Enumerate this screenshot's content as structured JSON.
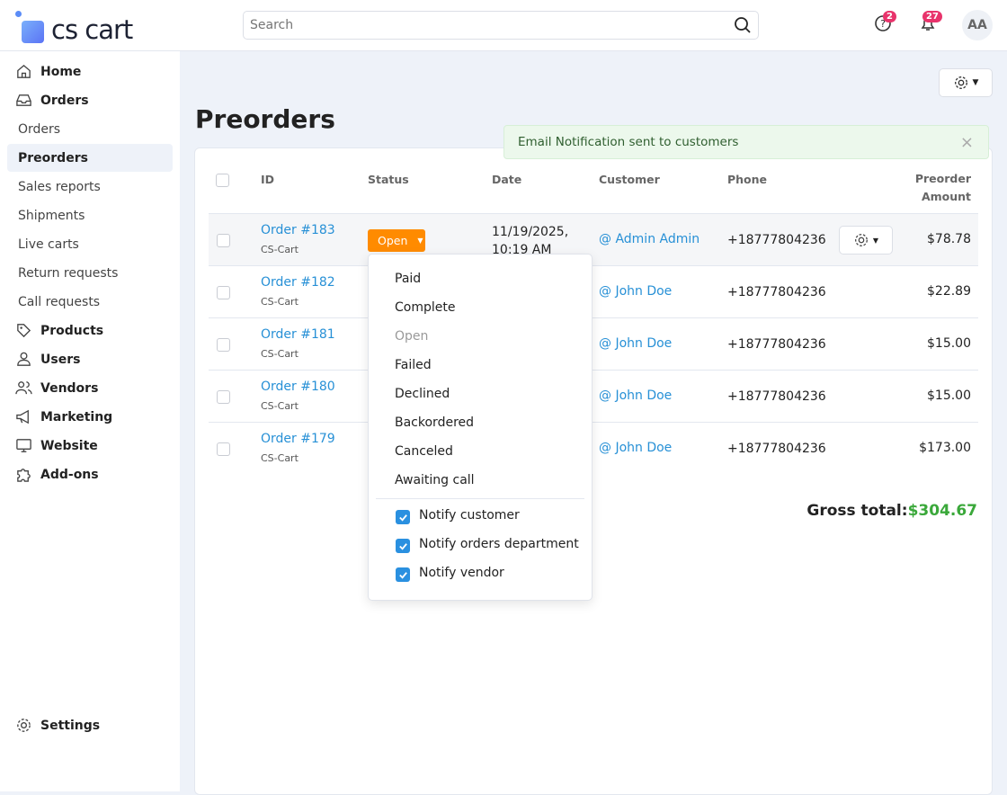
{
  "app": {
    "logo": "cs cart"
  },
  "header": {
    "search_placeholder": "Search",
    "help_badge": "2",
    "notifications_badge": "27",
    "avatar": "AA"
  },
  "sidebar": {
    "items": [
      {
        "label": "Home",
        "type": "top",
        "icon": "home-icon"
      },
      {
        "label": "Orders",
        "type": "top",
        "icon": "inbox-icon"
      },
      {
        "label": "Orders",
        "type": "sub"
      },
      {
        "label": "Preorders",
        "type": "sub",
        "active": true
      },
      {
        "label": "Sales reports",
        "type": "sub"
      },
      {
        "label": "Shipments",
        "type": "sub"
      },
      {
        "label": "Live carts",
        "type": "sub"
      },
      {
        "label": "Return requests",
        "type": "sub"
      },
      {
        "label": "Call requests",
        "type": "sub"
      },
      {
        "label": "Products",
        "type": "top",
        "icon": "tag-icon"
      },
      {
        "label": "Users",
        "type": "top",
        "icon": "user-icon"
      },
      {
        "label": "Vendors",
        "type": "top",
        "icon": "users-icon"
      },
      {
        "label": "Marketing",
        "type": "top",
        "icon": "megaphone-icon"
      },
      {
        "label": "Website",
        "type": "top",
        "icon": "monitor-icon"
      },
      {
        "label": "Add-ons",
        "type": "top",
        "icon": "puzzle-icon"
      }
    ],
    "settings": "Settings"
  },
  "page": {
    "title": "Preorders",
    "notification": "Email Notification sent to customers",
    "close": "×"
  },
  "table": {
    "headers": {
      "id": "ID",
      "status": "Status",
      "date": "Date",
      "customer": "Customer",
      "phone": "Phone",
      "amount_1": "Preorder",
      "amount_2": "Amount"
    },
    "rows": [
      {
        "id": "Order #183",
        "company": "CS-Cart",
        "status": "Open",
        "date_1": "11/19/2025,",
        "date_2": "10:19 AM",
        "customer": "@ Admin Admin",
        "phone": "+18777804236",
        "amount": "$78.78"
      },
      {
        "id": "Order #182",
        "company": "CS-Cart",
        "customer": "@ John Doe",
        "phone": "+18777804236",
        "amount": "$22.89"
      },
      {
        "id": "Order #181",
        "company": "CS-Cart",
        "customer": "@ John Doe",
        "phone": "+18777804236",
        "amount": "$15.00"
      },
      {
        "id": "Order #180",
        "company": "CS-Cart",
        "customer": "@ John Doe",
        "phone": "+18777804236",
        "amount": "$15.00"
      },
      {
        "id": "Order #179",
        "company": "CS-Cart",
        "customer": "@ John Doe",
        "phone": "+18777804236",
        "amount": "$173.00"
      }
    ]
  },
  "dropdown": {
    "statuses": [
      "Paid",
      "Complete",
      "Open",
      "Failed",
      "Declined",
      "Backordered",
      "Canceled",
      "Awaiting call"
    ],
    "notify": [
      "Notify customer",
      "Notify orders department",
      "Notify vendor"
    ]
  },
  "totals": {
    "label": "Gross total:",
    "value": "$304.67"
  },
  "colors": {
    "accent": "#2790d6",
    "status_open": "#ff8b00",
    "total": "#3aa83a"
  }
}
